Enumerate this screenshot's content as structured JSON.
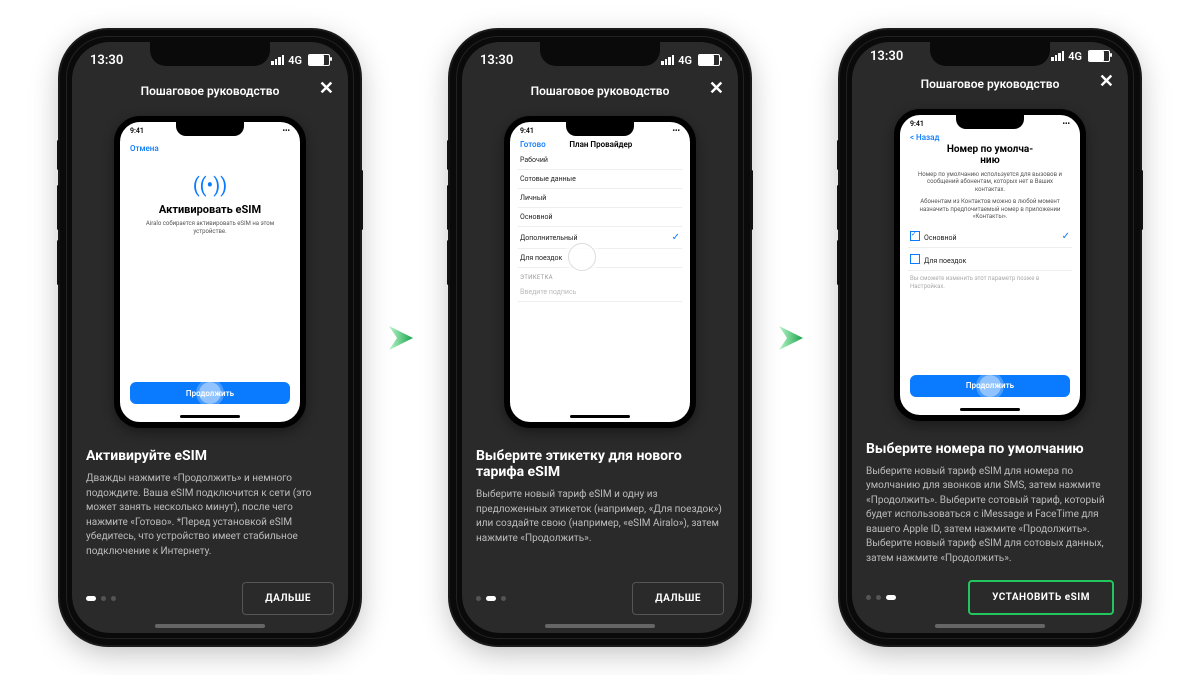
{
  "status": {
    "time": "13:30",
    "network": "4G"
  },
  "header": {
    "title": "Пошаговое руководство"
  },
  "arrow_icon": "chevron-right",
  "screens": [
    {
      "mini": {
        "nav_left": "Отмена",
        "title": "Активировать eSIM",
        "subtitle": "Airalo собирается активировать eSIM на этом устройстве.",
        "primary": "Продолжить"
      },
      "heading": "Активируйте eSIM",
      "body": "Дважды нажмите «Продолжить» и немного подождите. Ваша eSIM подключится к сети (это может занять несколько минут), после чего нажмите «Готово». *Перед установкой eSIM убедитесь, что устройство имеет стабильное подключение к Интернету.",
      "button": "ДАЛЬШЕ",
      "page_active": 0
    },
    {
      "mini": {
        "nav_left": "Готово",
        "nav_title": "План Провайдер",
        "rows": [
          "Рабочий",
          "Сотовые данные",
          "Личный",
          "Основной",
          "Дополнительный",
          "Для поездок"
        ],
        "checked_index": 4,
        "section_label": "ЭТИКЕТКА",
        "ghost_row": "Введите подпись"
      },
      "heading": "Выберите этикетку для нового тарифа eSIM",
      "body": "Выберите новый тариф eSIM и одну из предложенных этикеток (например, «Для поездок») или создайте свою (например, «eSIM Airalo»), затем нажмите «Продолжить».",
      "button": "ДАЛЬШЕ",
      "page_active": 1
    },
    {
      "mini": {
        "nav_left": "< Назад",
        "title": "Номер по умолча-\nнию",
        "para1": "Номер по умолчанию используется для вызовов и сообщений абонентам, которых нет в Ваших контактах.",
        "para2": "Абонентам из Контактов можно в любой момент назначить предпочитаемый номер в приложении «Контакты».",
        "opts": [
          "Основной",
          "Для поездок"
        ],
        "checked_index": 0,
        "footnote": "Вы сможете изменить этот параметр позже в Настройках.",
        "primary": "Продолжить"
      },
      "heading": "Выберите номера по умолчанию",
      "body": "Выберите новый тариф eSIM для номера по умолчанию для звонков или SMS, затем нажмите «Продолжить». Выберите сотовый тариф, который будет использоваться с iMessage и FaceTime для вашего Apple ID, затем нажмите «Продолжить». Выберите новый тариф eSIM для сотовых данных, затем нажмите «Продолжить».",
      "button": "УСТАНОВИТЬ eSIM",
      "page_active": 2
    }
  ]
}
